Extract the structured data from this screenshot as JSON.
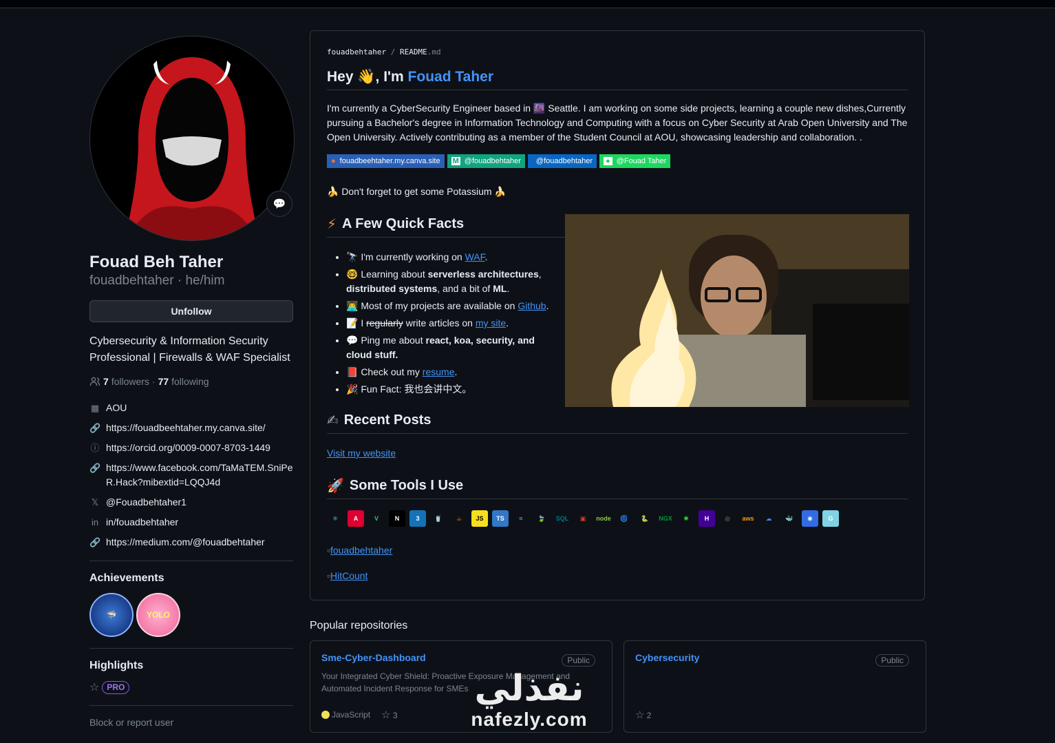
{
  "profile": {
    "full_name": "Fouad Beh Taher",
    "login": "fouadbehtaher",
    "pronouns": "he/him",
    "unfollow_label": "Unfollow",
    "bio": "Cybersecurity & Information Security Professional | Firewalls & WAF Specialist",
    "followers_count": "7",
    "followers_label": "followers",
    "following_count": "77",
    "following_label": "following",
    "details": {
      "organization": "AOU",
      "website": "https://fouadbeehtaher.my.canva.site/",
      "orcid": "https://orcid.org/0009-0007-8703-1449",
      "facebook": "https://www.facebook.com/TaMaTEM.SniPeR.Hack?mibextid=LQQJ4d",
      "twitter": "@Fouadbehtaher1",
      "linkedin": "in/fouadbehtaher",
      "medium": "https://medium.com/@fouadbehtaher"
    },
    "achievements_title": "Achievements",
    "achievement_yolo": "YOLO",
    "highlights_title": "Highlights",
    "pro_badge": "PRO",
    "block_label": "Block or report user"
  },
  "readme": {
    "crumb_user": "fouadbehtaher",
    "crumb_sep": "/",
    "crumb_file": "README",
    "crumb_ext": ".md",
    "greeting_prefix": "Hey",
    "greeting_emoji": "👋",
    "greeting_mid": ", I'm",
    "greeting_name": "Fouad Taher",
    "intro": "I'm currently a CyberSecurity Engineer based in 🌆 Seattle. I am working on some side projects, learning a couple new dishes,Currently pursuing a Bachelor's degree in Information Technology and Computing with a focus on Cyber Security at Arab Open University and The Open University. Actively contributing as a member of the Student Council at AOU, showcasing leadership and collaboration. .",
    "shields": [
      {
        "label": "fouadbeehtaher.my.canva.site",
        "color": "#2a5fb5",
        "icon": "●"
      },
      {
        "label": "@fouadbehtaher",
        "color": "#12a37f",
        "icon": "M"
      },
      {
        "label": "@fouadbehtaher",
        "color": "#0a66c2",
        "icon": ""
      },
      {
        "label": "@Fouad Taher",
        "color": "#1ed760",
        "icon": "●"
      }
    ],
    "potassium": "🍌 Don't forget to get some Potassium 🍌",
    "facts_title": "A Few Quick Facts",
    "facts_emoji": "⚡",
    "facts": {
      "f1_pre": "🔭 I'm currently working on ",
      "f1_link": "WAF",
      "f1_post": ".",
      "f2_pre": "🤓 Learning about ",
      "f2_b1": "serverless architectures",
      "f2_mid": ", ",
      "f2_b2": "distributed systems",
      "f2_mid2": ", and a bit of ",
      "f2_b3": "ML",
      "f2_post": ".",
      "f3_pre": "👨‍💻 Most of my projects are available on ",
      "f3_link": "Github",
      "f3_post": ".",
      "f4_pre": "📝 I ",
      "f4_strike": "regularly",
      "f4_mid": " write articles on ",
      "f4_link": "my site",
      "f4_post": ".",
      "f5_pre": "💬 Ping me about ",
      "f5_b": "react, koa, security, and cloud stuff",
      "f5_post": ".",
      "f6_pre": "📕 Check out my ",
      "f6_link": "resume",
      "f6_post": ".",
      "f7": "🎉 Fun Fact: 我也会讲中文。"
    },
    "posts_title": "Recent Posts",
    "posts_emoji": "✍",
    "visit_link": "Visit my website",
    "tools_title": "Some Tools I Use",
    "tools_emoji": "🚀",
    "tools": [
      {
        "name": "react",
        "label": "⚛",
        "bg": "transparent",
        "fg": "#61dafb"
      },
      {
        "name": "angular",
        "label": "A",
        "bg": "#dd0031",
        "fg": "#fff"
      },
      {
        "name": "vue",
        "label": "V",
        "bg": "transparent",
        "fg": "#41b883"
      },
      {
        "name": "nextjs",
        "label": "N",
        "bg": "#000",
        "fg": "#fff"
      },
      {
        "name": "css3",
        "label": "3",
        "bg": "#1572b6",
        "fg": "#fff"
      },
      {
        "name": "redux",
        "label": "🥤",
        "bg": "transparent",
        "fg": "#d33"
      },
      {
        "name": "java",
        "label": "☕",
        "bg": "transparent",
        "fg": "#e76f00"
      },
      {
        "name": "javascript",
        "label": "JS",
        "bg": "#f7df1e",
        "fg": "#000"
      },
      {
        "name": "typescript",
        "label": "TS",
        "bg": "#3178c6",
        "fg": "#fff"
      },
      {
        "name": "tailwind",
        "label": "≈",
        "bg": "transparent",
        "fg": "#38bdf8"
      },
      {
        "name": "mongodb",
        "label": "🍃",
        "bg": "transparent",
        "fg": "#47a248"
      },
      {
        "name": "mysql",
        "label": "SQL",
        "bg": "transparent",
        "fg": "#00758f"
      },
      {
        "name": "redis",
        "label": "▣",
        "bg": "transparent",
        "fg": "#dc382d"
      },
      {
        "name": "nodejs",
        "label": "node",
        "bg": "transparent",
        "fg": "#8cc84b"
      },
      {
        "name": "spring",
        "label": "🌀",
        "bg": "transparent",
        "fg": "#6db33f"
      },
      {
        "name": "python",
        "label": "🐍",
        "bg": "transparent",
        "fg": "#3776ab"
      },
      {
        "name": "nginx",
        "label": "NGX",
        "bg": "transparent",
        "fg": "#009639"
      },
      {
        "name": "gitlab-ci",
        "label": "✺",
        "bg": "transparent",
        "fg": "#3bd13b"
      },
      {
        "name": "heroku",
        "label": "H",
        "bg": "#430098",
        "fg": "#fff"
      },
      {
        "name": "github",
        "label": "◎",
        "bg": "transparent",
        "fg": "#888"
      },
      {
        "name": "aws",
        "label": "aws",
        "bg": "transparent",
        "fg": "#ff9900"
      },
      {
        "name": "gcp",
        "label": "☁",
        "bg": "transparent",
        "fg": "#4285f4"
      },
      {
        "name": "docker",
        "label": "🐳",
        "bg": "transparent",
        "fg": "#2496ed"
      },
      {
        "name": "kubernetes",
        "label": "⎈",
        "bg": "#326ce5",
        "fg": "#fff"
      },
      {
        "name": "gopher",
        "label": "G",
        "bg": "#7fd3e6",
        "fg": "#fff"
      }
    ],
    "stats_alt": "fouadbehtaher",
    "hitcount_alt": "HitCount"
  },
  "popular": {
    "title": "Popular repositories",
    "repos": [
      {
        "name": "Sme-Cyber-Dashboard",
        "visibility": "Public",
        "description": "Your Integrated Cyber Shield: Proactive Exposure Management and Automated Incident Response for SMEs",
        "language": "JavaScript",
        "stars": "3"
      },
      {
        "name": "Cybersecurity",
        "visibility": "Public",
        "description": "",
        "language": "",
        "stars": "2"
      }
    ]
  },
  "watermark": {
    "arabic": "نفذلي",
    "domain": "nafezly.com"
  },
  "colors": {
    "background": "#0d1117",
    "border": "#30363d",
    "link": "#4493f8",
    "muted": "#7d8590"
  }
}
